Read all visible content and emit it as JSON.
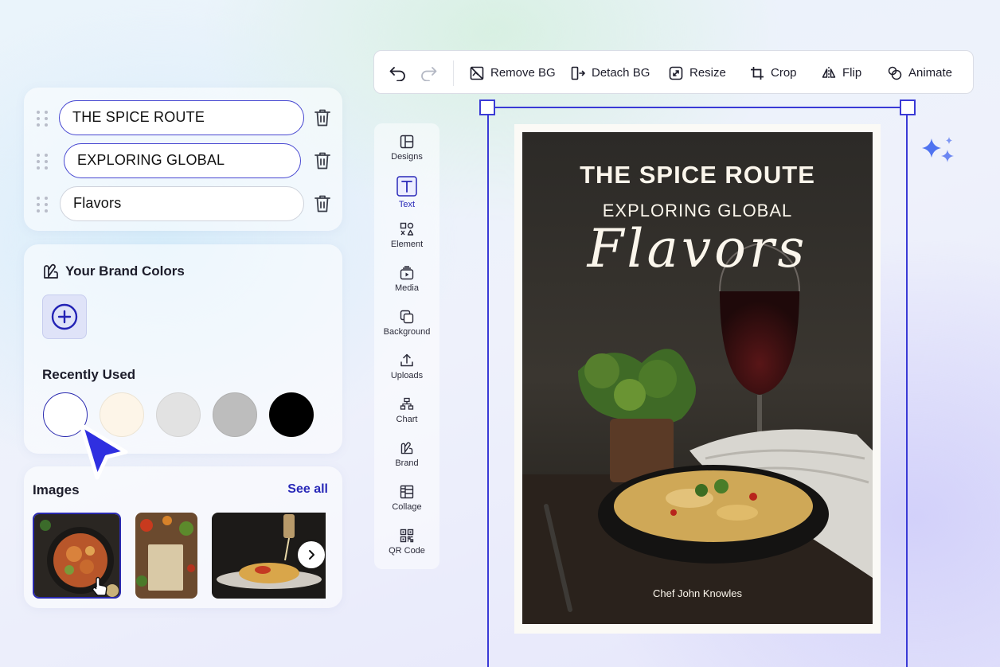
{
  "text_layers": [
    {
      "value": "THE SPICE ROUTE",
      "selected": true
    },
    {
      "value": "EXPLORING GLOBAL",
      "selected": true
    },
    {
      "value": "Flavors",
      "selected": false
    }
  ],
  "brand": {
    "title": "Your Brand Colors",
    "recently_used_label": "Recently Used",
    "recent_colors": [
      "#ffffff",
      "#fdf5e8",
      "#e2e2e2",
      "#bdbdbd",
      "#000000"
    ]
  },
  "images": {
    "title": "Images",
    "see_all": "See all"
  },
  "toolbar": {
    "remove_bg": "Remove BG",
    "detach_bg": "Detach BG",
    "resize": "Resize",
    "crop": "Crop",
    "flip": "Flip",
    "animate": "Animate"
  },
  "rail": {
    "designs": "Designs",
    "text": "Text",
    "element": "Element",
    "media": "Media",
    "background": "Background",
    "uploads": "Uploads",
    "chart": "Chart",
    "brand": "Brand",
    "collage": "Collage",
    "qr_code": "QR Code"
  },
  "poster": {
    "title": "THE SPICE ROUTE",
    "subtitle": "EXPLORING GLOBAL",
    "script": "Flavors",
    "author": "Chef John Knowles"
  },
  "colors": {
    "accent": "#3a3ad6",
    "link": "#2929b8"
  }
}
